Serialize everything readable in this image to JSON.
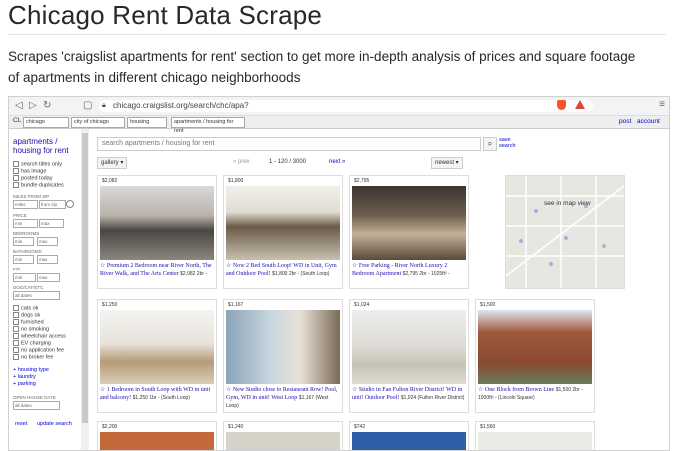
{
  "readme": {
    "title": "Chicago Rent Data Scrape",
    "description": "Scrapes 'craigslist apartments for rent' section to get more in-depth analysis of prices and square footage of apartments in different chicago neighborhoods"
  },
  "browser": {
    "url": "chicago.craigslist.org/search/chc/apa?"
  },
  "cl_bar": {
    "logo": "CL",
    "crumbs": [
      "chicago",
      "city of chicago",
      "housing",
      "apartments / housing for rent"
    ],
    "post": "post",
    "account": "account"
  },
  "sidebar": {
    "heading": "apartments / housing for rent",
    "checks": [
      "search titles only",
      "has image",
      "posted today",
      "bundle duplicates"
    ],
    "miles_label": "MILES FROM ZIP",
    "miles_placeholder": "miles",
    "zip_placeholder": "from zip",
    "price_label": "PRICE",
    "min_placeholder": "min",
    "max_placeholder": "max",
    "bedrooms_label": "BEDROOMS",
    "bathrooms_label": "BATHROOMS",
    "ft2_label": "FT²",
    "min_option": "min",
    "max_option": "max",
    "sqft_placeholder": "min",
    "sqft_max_placeholder": "max",
    "dates_label": "DOG/CAT/ETC",
    "all_dates": "all dates",
    "amenities": [
      "cats ok",
      "dogs ok",
      "furnished",
      "no smoking",
      "wheelchair access",
      "EV charging",
      "no application fee",
      "no broker fee"
    ],
    "expand_links": [
      "housing type",
      "laundry",
      "parking"
    ],
    "open_house_label": "OPEN HOUSE DATE",
    "open_house_value": "all dates",
    "reset": "reset",
    "update": "update search"
  },
  "main": {
    "search_placeholder": "search apartments / housing for rent",
    "save_search": "save search",
    "view_mode": "gallery",
    "prev": "« prev",
    "range": "1 - 120 / 3000",
    "next": "next »",
    "sort": "newest",
    "map_label": "see in map view"
  },
  "cards": [
    {
      "tag": "$2,082",
      "title": "Premium 2 Bedroom near River North, The River Walk, and The Arts Center",
      "meta": "$2,082 2br -"
    },
    {
      "tag": "$1,800",
      "title": "Now 2 Bed South Loop! WD in Unit, Gym and Outdoor Pool!",
      "meta": "$1,800 2br - (South Loop)"
    },
    {
      "tag": "$2,795",
      "title": "Free Parking - River North Luxury 2 Bedroom Apartment",
      "meta": "$2,795 2br - 1025ft² -"
    },
    {
      "tag": "$1,250",
      "title": "1 Bedroom in South Loop with WD in unit and balcony!",
      "meta": "$1,250 1br - (South Loop)"
    },
    {
      "tag": "$1,167",
      "title": "New Studio close to Restaurant Row! Pool, Gym, WD in unit! West Loop",
      "meta": "$1,167 (West Loop)"
    },
    {
      "tag": "$1,024",
      "title": "Studio in Fan Fulton River District! WD in unit! Outdoor Pool!",
      "meta": "$1,024 (Fulton River District)"
    },
    {
      "tag": "$1,500",
      "title": "One Block from Brown Line",
      "meta": "$1,500 2br - 1000ft² - (Lincoln Square)"
    }
  ],
  "row3_tags": [
    "$2,200",
    "$1,240",
    "$742",
    "$1,560"
  ]
}
